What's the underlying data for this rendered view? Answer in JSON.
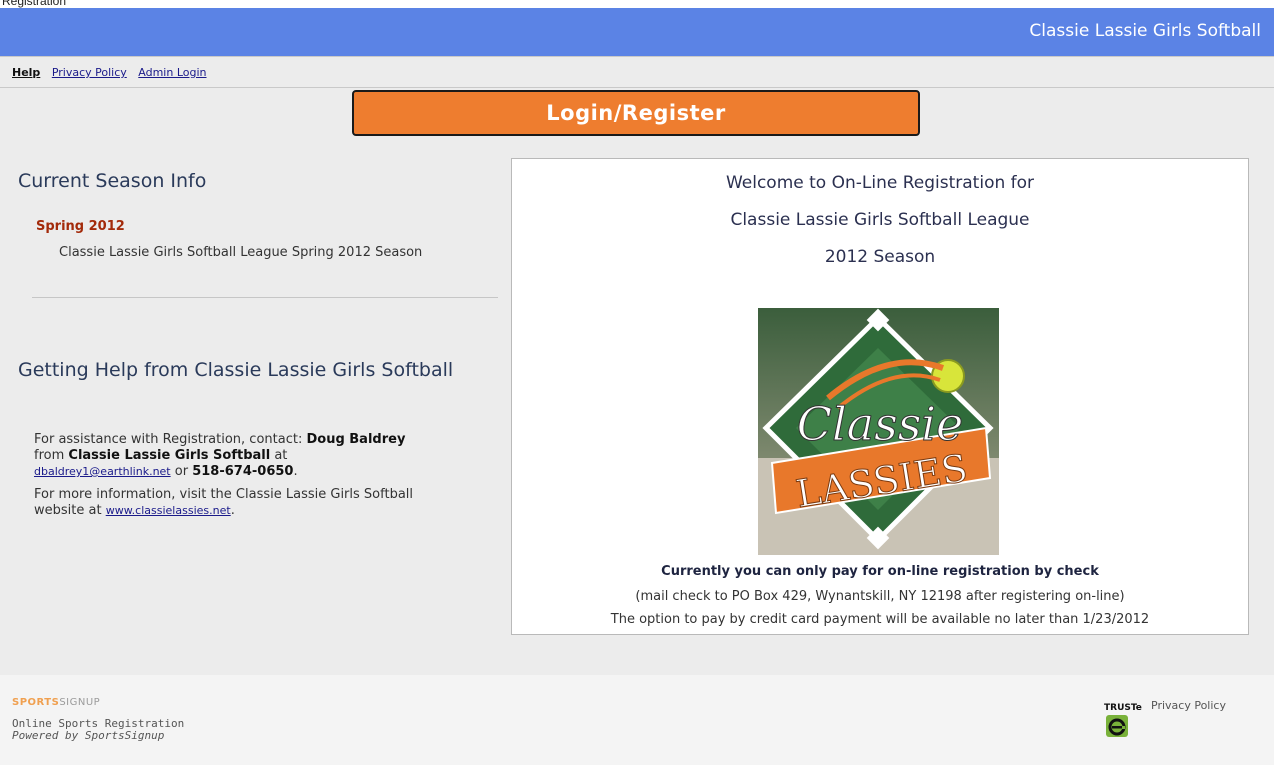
{
  "browser_fragment": "Registration",
  "header": {
    "title": "Classie Lassie Girls Softball"
  },
  "top_links": {
    "help": "Help",
    "privacy": "Privacy Policy",
    "admin": "Admin Login"
  },
  "login_button": "Login/Register",
  "left": {
    "season_heading": "Current Season Info",
    "season_name": "Spring 2012",
    "season_description": "Classie Lassie Girls Softball League Spring 2012 Season",
    "help_heading": "Getting Help from Classie Lassie Girls Softball",
    "help": {
      "assist_prefix": "For assistance with Registration, contact:",
      "contact_name": "Doug Baldrey",
      "from_word": "from",
      "org": "Classie Lassie Girls Softball",
      "at_word": "at",
      "email": "dbaldrey1@earthlink.net",
      "or_word": "or",
      "phone": "518-674-0650",
      "period": ".",
      "info_prefix": "For more information, visit the Classie Lassie Girls Softball website at",
      "website": "www.classielassies.net",
      "info_suffix": "."
    }
  },
  "panel": {
    "welcome_line1": "Welcome to On-Line Registration for",
    "welcome_line2": "Classie Lassie Girls Softball League",
    "welcome_line3": "2012 Season",
    "logo_top": "Classie",
    "logo_bottom": "LASSIES",
    "pay_notice": "Currently you can only pay for on-line registration by check",
    "pay_mail": "(mail check to PO Box 429, Wynantskill, NY 12198 after registering on-line)",
    "pay_credit": "The option to pay by credit card payment will be available no later than 1/23/2012"
  },
  "footer": {
    "brand_sports": "SPORTS",
    "brand_signup": "SIGNUP",
    "line1": "Online Sports Registration",
    "line2": "Powered by SportsSignup",
    "truste": "TRUSTe",
    "privacy": "Privacy Policy"
  },
  "colors": {
    "header_bg": "#5b83e5",
    "button_bg": "#ee7d2f",
    "season_name": "#a32a0a",
    "logo_green": "#2f6b3a",
    "logo_orange": "#e8782b"
  }
}
